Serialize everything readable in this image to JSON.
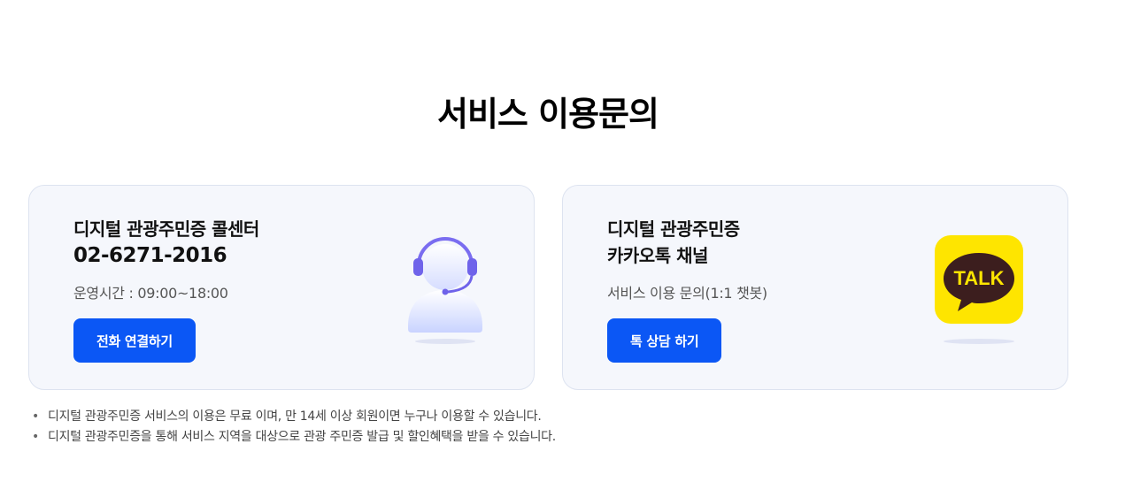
{
  "page": {
    "title": "서비스 이용문의"
  },
  "call_center_card": {
    "title": "디지털 관광주민증 콜센터",
    "phone": "02-6271-2016",
    "hours": "운영시간 : 09:00~18:00",
    "button_label": "전화 연결하기",
    "icon": "headset-agent-icon"
  },
  "kakao_card": {
    "title_line1": "디지털 관광주민증",
    "title_line2": "카카오톡 채널",
    "description": "서비스 이용 문의(1:1 챗봇)",
    "button_label": "톡 상담 하기",
    "icon": "kakaotalk-icon",
    "logo_text": "TALK"
  },
  "notes": [
    "디지털 관광주민증 서비스의 이용은 무료 이며, 만 14세 이상 회원이면 누구나 이용할 수 있습니다.",
    "디지털 관광주민증을 통해 서비스 지역을 대상으로 관광 주민증 발급 및 할인혜택을 받을 수 있습니다."
  ],
  "colors": {
    "primary_button": "#0b57f5",
    "card_background": "#f5f7fc",
    "kakao_yellow": "#fee500",
    "kakao_brown": "#3c1e1e"
  }
}
